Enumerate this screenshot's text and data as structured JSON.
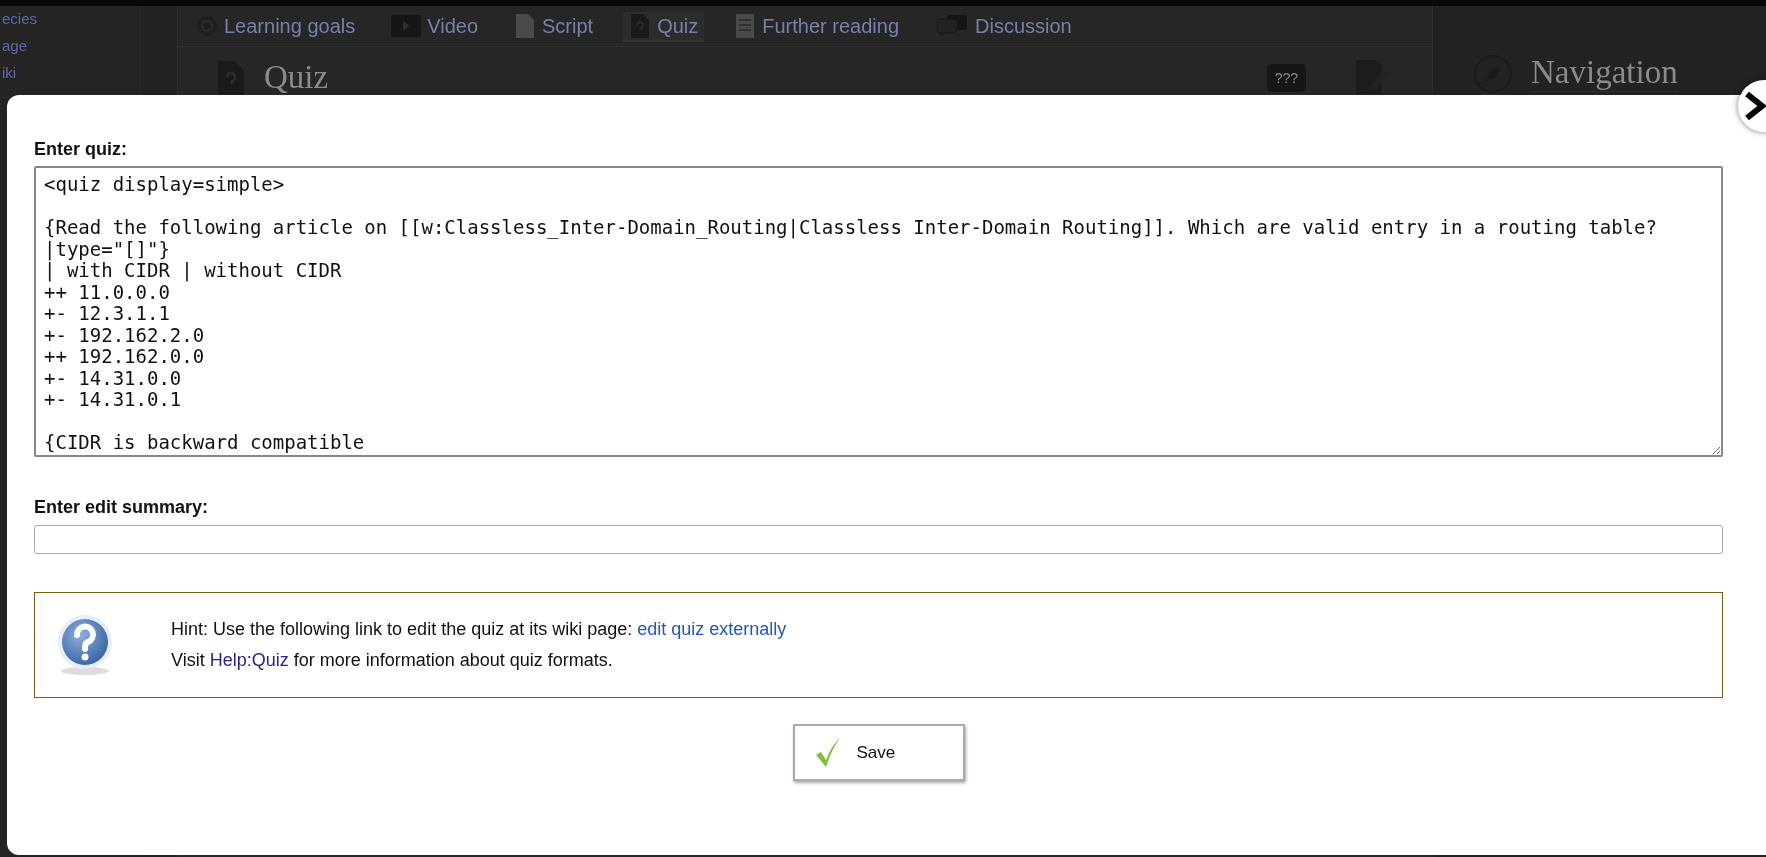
{
  "background_page": {
    "sidebar_items": [
      "ecies",
      "age",
      "iki"
    ],
    "tabs": [
      {
        "label": "Learning goals",
        "kind": "target",
        "selected": false
      },
      {
        "label": "Video",
        "kind": "video",
        "selected": false
      },
      {
        "label": "Script",
        "kind": "page",
        "selected": false
      },
      {
        "label": "Quiz",
        "kind": "quiz",
        "selected": true
      },
      {
        "label": "Further reading",
        "kind": "list",
        "selected": false
      },
      {
        "label": "Discussion",
        "kind": "chat",
        "selected": false
      }
    ],
    "page_title": "Quiz",
    "toolbar_badge": "???",
    "navigation_title": "Navigation"
  },
  "dialog": {
    "quiz_label": "Enter quiz:",
    "quiz_source": "<quiz display=simple>\n\n{Read the following article on [[w:Classless_Inter-Domain_Routing|Classless Inter-Domain Routing]]. Which are valid entry in a routing table?\n|type=\"[]\"}\n| with CIDR | without CIDR\n++ 11.0.0.0\n+- 12.3.1.1\n+- 192.162.2.0\n++ 192.162.0.0\n+- 14.31.0.0\n+- 14.31.0.1\n\n{CIDR is backward compatible",
    "summary_label": "Enter edit summary:",
    "hint": {
      "lines": [
        {
          "before": "Hint: Use the following link to edit the quiz at its wiki page: ",
          "link": "edit quiz externally"
        },
        {
          "before": "Visit ",
          "link": "Help:Quiz",
          "after": " for more information about quiz formats."
        }
      ]
    },
    "save_button": "Save"
  }
}
